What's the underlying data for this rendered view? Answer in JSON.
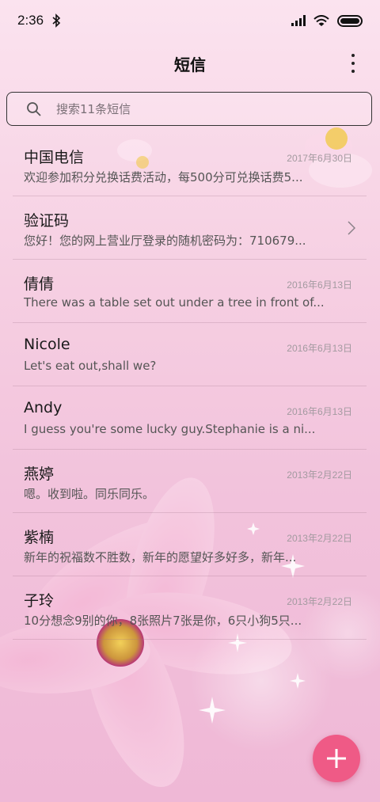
{
  "status_bar": {
    "time": "2:36",
    "icons": [
      "bluetooth-icon",
      "signal-icon",
      "wifi-icon",
      "battery-icon"
    ]
  },
  "header": {
    "title": "短信",
    "menu_icon": "more-vertical-icon"
  },
  "search": {
    "placeholder": "搜索11条短信",
    "icon": "search-icon"
  },
  "messages": [
    {
      "name": "中国电信",
      "date": "2017年6月30日",
      "preview": "欢迎参加积分兑换话费活动，每500分可兑换话费5..."
    },
    {
      "name": "验证码",
      "date": "",
      "preview": "您好！您的网上营业厅登录的随机密码为：710679...",
      "has_chevron": true
    },
    {
      "name": "倩倩",
      "date": "2016年6月13日",
      "preview": "There was a table set out under a tree in front of..."
    },
    {
      "name": "Nicole",
      "date": "2016年6月13日",
      "preview": "Let's eat out,shall we?"
    },
    {
      "name": "Andy",
      "date": "2016年6月13日",
      "preview": "I guess you're some lucky guy.Stephanie is a ni..."
    },
    {
      "name": "燕婷",
      "date": "2013年2月22日",
      "preview": "嗯。收到啦。同乐同乐。"
    },
    {
      "name": "紫楠",
      "date": "2013年2月22日",
      "preview": "新年的祝福数不胜数，新年的愿望好多好多，新年..."
    },
    {
      "name": "子玲",
      "date": "2013年2月22日",
      "preview": "10分想念9别的你，8张照片7张是你，6只小狗5只..."
    }
  ],
  "fab": {
    "icon": "plus-icon"
  },
  "colors": {
    "accent": "#ef5a86",
    "background": "#f6cfe2"
  }
}
